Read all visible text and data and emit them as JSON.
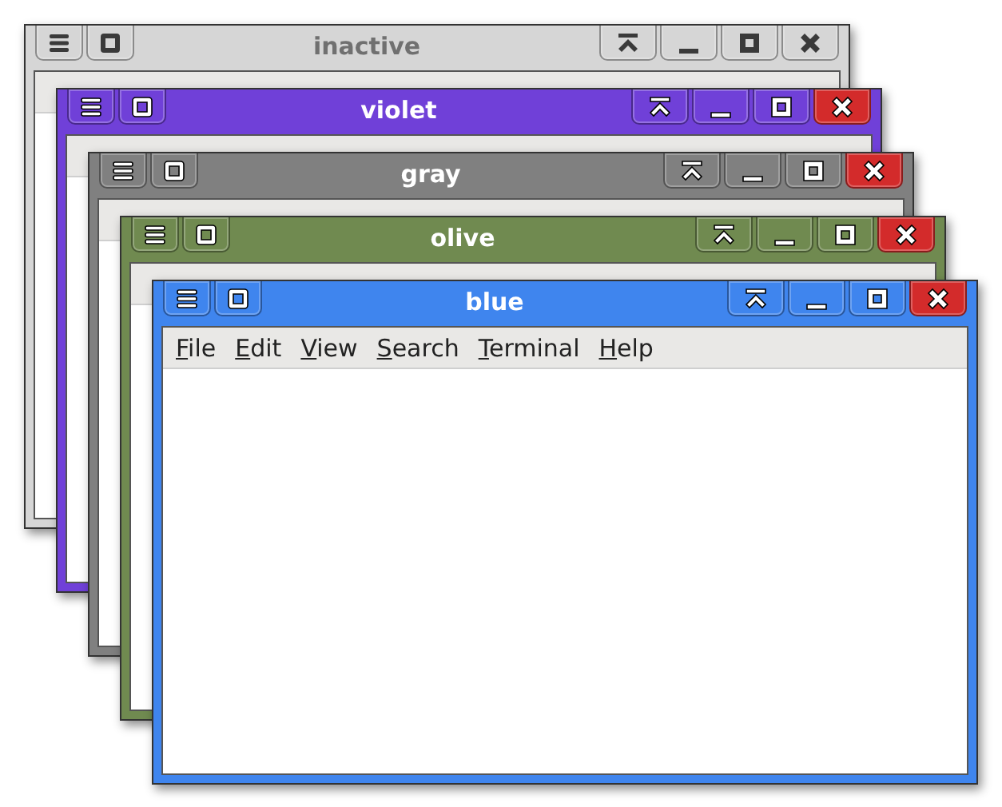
{
  "windows": [
    {
      "title": "inactive",
      "active": false,
      "color": "#d6d6d6"
    },
    {
      "title": "violet",
      "active": true,
      "color": "#7040d8"
    },
    {
      "title": "gray",
      "active": true,
      "color": "#808080"
    },
    {
      "title": "olive",
      "active": true,
      "color": "#708a50"
    },
    {
      "title": "blue",
      "active": true,
      "color": "#3f85ee",
      "menu": [
        "File",
        "Edit",
        "View",
        "Search",
        "Terminal",
        "Help"
      ]
    }
  ]
}
